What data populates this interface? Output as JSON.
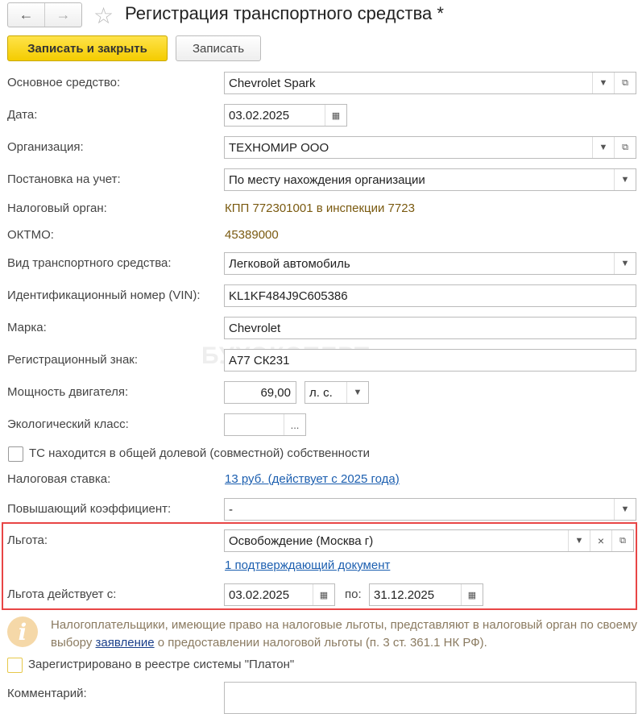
{
  "header": {
    "title": "Регистрация транспортного средства *",
    "back": "←",
    "forward": "→"
  },
  "toolbar": {
    "save_close": "Записать и закрыть",
    "save": "Записать"
  },
  "watermark": "БУХЭКСПЕРТ",
  "form": {
    "asset_label": "Основное средство:",
    "asset": "Chevrolet Spark",
    "date_label": "Дата:",
    "date": "03.02.2025",
    "org_label": "Организация:",
    "org": "ТЕХНОМИР ООО",
    "reg_label": "Постановка на учет:",
    "reg": "По месту нахождения организации",
    "tax_office_label": "Налоговый орган:",
    "tax_office": "КПП 772301001 в инспекции 7723",
    "oktmo_label": "ОКТМО:",
    "oktmo": "45389000",
    "type_label": "Вид транспортного средства:",
    "type": "Легковой автомобиль",
    "vin_label": "Идентификационный номер (VIN):",
    "vin": "KL1KF484J9C605386",
    "brand_label": "Марка:",
    "brand": "Chevrolet",
    "plate_label": "Регистрационный знак:",
    "plate": "А77 СК231",
    "power_label": "Мощность двигателя:",
    "power": "69,00",
    "power_unit": "л. с.",
    "eco_label": "Экологический класс:",
    "eco": "",
    "eco_btn": "...",
    "shared_label": "ТС находится в общей долевой (совместной) собственности",
    "rate_label": "Налоговая ставка:",
    "rate": "13 руб. (действует с 2025 года)",
    "coef_label": "Повышающий коэффициент:",
    "coef": "-",
    "benefit_label": "Льгота:",
    "benefit": "Освобождение (Москва г)",
    "benefit_doc": "1 подтверждающий документ",
    "benefit_from_label": "Льгота действует с:",
    "benefit_from": "03.02.2025",
    "to_label": "по:",
    "benefit_to": "31.12.2025",
    "note_part1": "Налогоплательщики, имеющие право на налоговые льготы, представляют в налоговый орган по своему выбору ",
    "note_link": "заявление",
    "note_part2": " о предоставлении налоговой льготы (п. 3 ст. 361.1 НК РФ).",
    "platon_label": "Зарегистрировано в реестре системы \"Платон\"",
    "comment_label": "Комментарий:",
    "comment": ""
  }
}
